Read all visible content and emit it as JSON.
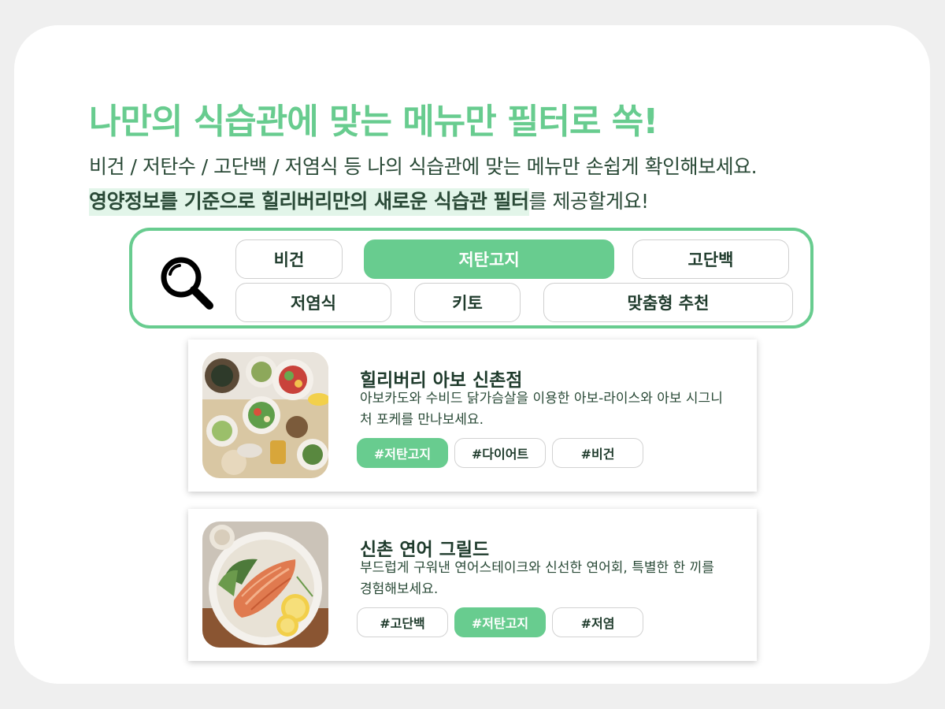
{
  "header": {
    "headline": "나만의 식습관에 맞는 메뉴만 필터로 쏙!",
    "subtitle_line1": "비건 / 저탄수 / 고단백 / 저염식 등 나의 식습관에 맞는 메뉴만 손쉽게 확인해보세요.",
    "subtitle_line2_highlight": "영양정보를 기준으로 힐리버리만의 새로운 식습관 필터",
    "subtitle_line2_rest": "를 제공할게요!"
  },
  "filters": {
    "icon": "search-icon",
    "chips": [
      {
        "label": "비건",
        "active": false
      },
      {
        "label": "저탄고지",
        "active": true
      },
      {
        "label": "고단백",
        "active": false
      },
      {
        "label": "저염식",
        "active": false
      },
      {
        "label": "키토",
        "active": false
      },
      {
        "label": "맞춤형 추천",
        "active": false
      }
    ]
  },
  "restaurants": [
    {
      "name": "힐리버리 아보 신촌점",
      "description": "아보카도와 수비드 닭가슴살을 이용한 아보-라이스와 아보 시그니처 포케를 만나보세요.",
      "tags": [
        {
          "label": "#저탄고지",
          "active": true
        },
        {
          "label": "#다이어트",
          "active": false
        },
        {
          "label": "#비건",
          "active": false
        }
      ]
    },
    {
      "name": "신촌 연어 그릴드",
      "description": "부드럽게 구워낸 연어스테이크와 신선한 연어회, 특별한 한 끼를 경험해보세요.",
      "tags": [
        {
          "label": "#고단백",
          "active": false
        },
        {
          "label": "#저탄고지",
          "active": true
        },
        {
          "label": "#저염",
          "active": false
        }
      ]
    }
  ],
  "colors": {
    "accent": "#68cc8f",
    "text": "#1f3b2c",
    "highlight_bg": "#e2f5e9"
  }
}
